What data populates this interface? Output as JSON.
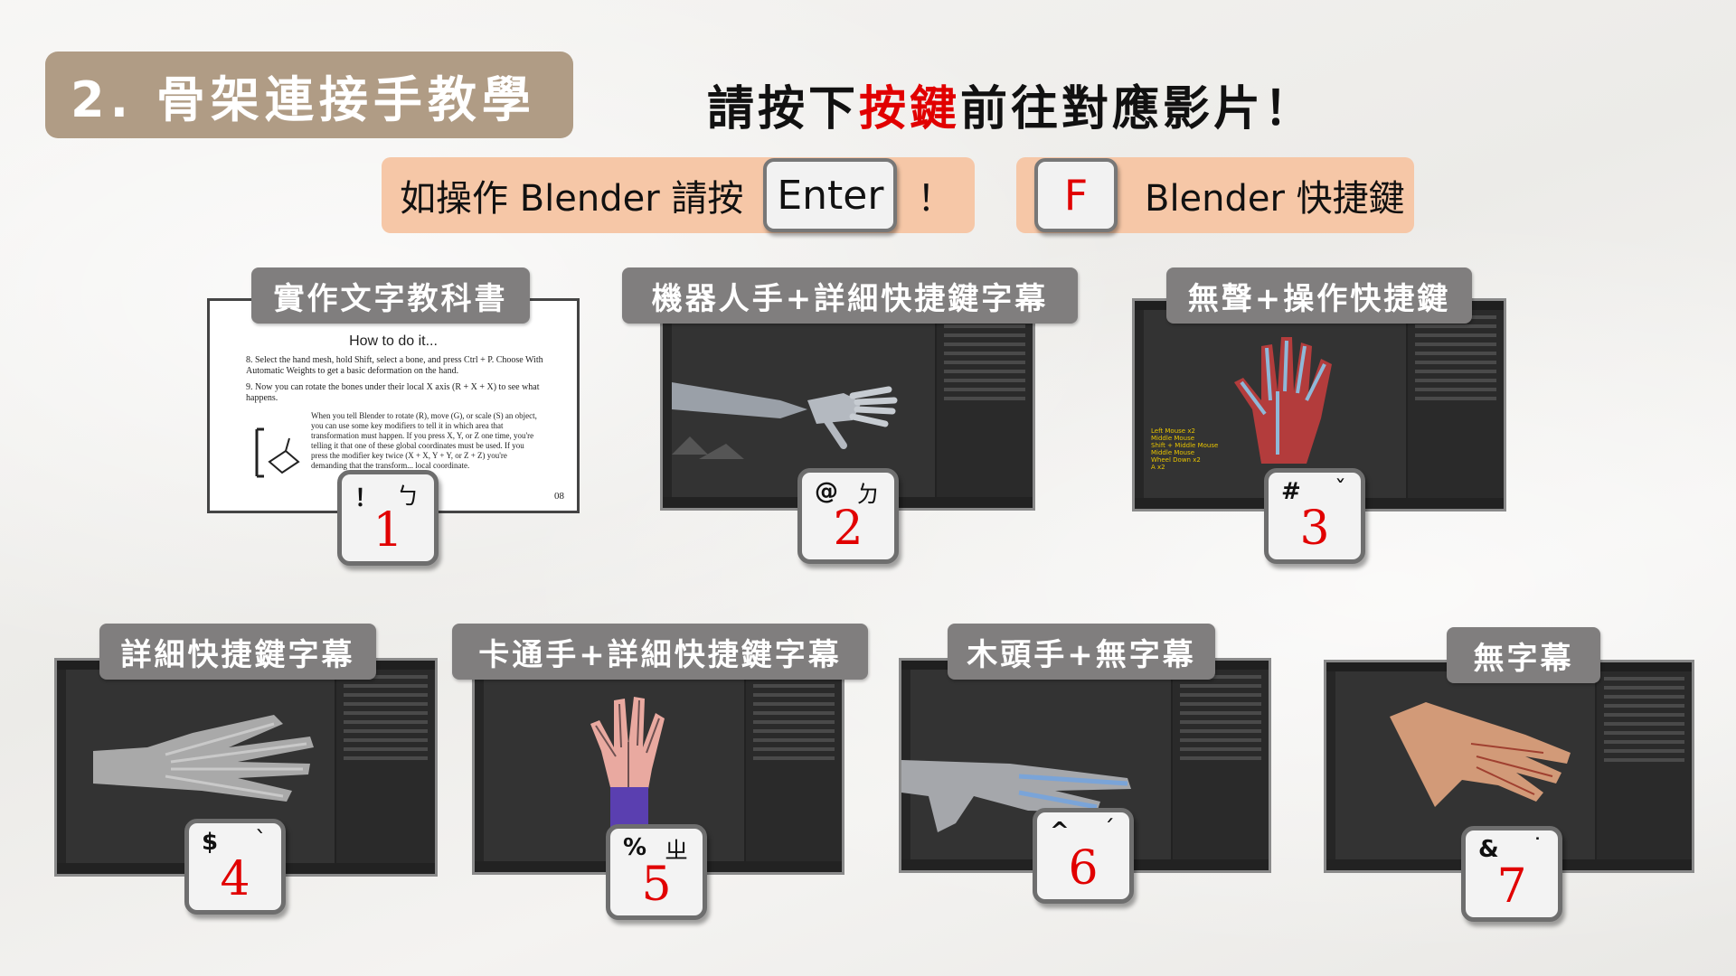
{
  "header": {
    "title": "2. 骨架連接手教學",
    "headline_pre": "請按下",
    "headline_red": "按鍵",
    "headline_post": "前往對應影片！"
  },
  "instructions": {
    "pill1_text": "如操作 Blender 請按",
    "enter_key": "Enter",
    "pill1_end": "！",
    "f_key": "F",
    "pill2_text": "Blender 快捷鍵"
  },
  "doc_preview": {
    "heading": "How to do it...",
    "step8": "8.  Select the hand mesh, hold Shift, select a bone, and press Ctrl + P. Choose With Automatic Weights to get a basic deformation on the hand.",
    "step9": "9.  Now you can rotate the bones under their local X axis (R + X + X) to see what happens.",
    "note": "When you tell Blender to rotate (R), move (G), or scale (S) an object, you can use some key modifiers to tell it in which area that transformation must happen. If you press X, Y, or Z one time, you're telling it that one of these global coordinates must be used. If you press the modifier key twice (X + X, Y + Y, or Z + Z) you're demanding that the transform... local coordinate.",
    "page": "08"
  },
  "videos": [
    {
      "label": "實作文字教科書",
      "sym": "！",
      "zhuyin": "ㄅ",
      "num": "1"
    },
    {
      "label": "機器人手+詳細快捷鍵字幕",
      "sym": "@",
      "zhuyin": "ㄉ",
      "num": "2"
    },
    {
      "label": "無聲+操作快捷鍵",
      "sym": "#",
      "zhuyin": "ˇ",
      "num": "3"
    },
    {
      "label": "詳細快捷鍵字幕",
      "sym": "$",
      "zhuyin": "ˋ",
      "num": "4"
    },
    {
      "label": "卡通手+詳細快捷鍵字幕",
      "sym": "%",
      "zhuyin": "ㄓ",
      "num": "5"
    },
    {
      "label": "木頭手+無字幕",
      "sym": "^",
      "zhuyin": "ˊ",
      "num": "6"
    },
    {
      "label": "無字幕",
      "sym": "&",
      "zhuyin": "˙",
      "num": "7"
    }
  ],
  "screen3_overlay": "Left Mouse x2\nMiddle Mouse\nShift + Middle Mouse\nMiddle Mouse\nWheel Down x2\nA x2",
  "colors": {
    "title_bg": "#b09c85",
    "pill_bg": "#f6c7a7",
    "label_bg": "#807e7e",
    "accent_red": "#e10000"
  }
}
